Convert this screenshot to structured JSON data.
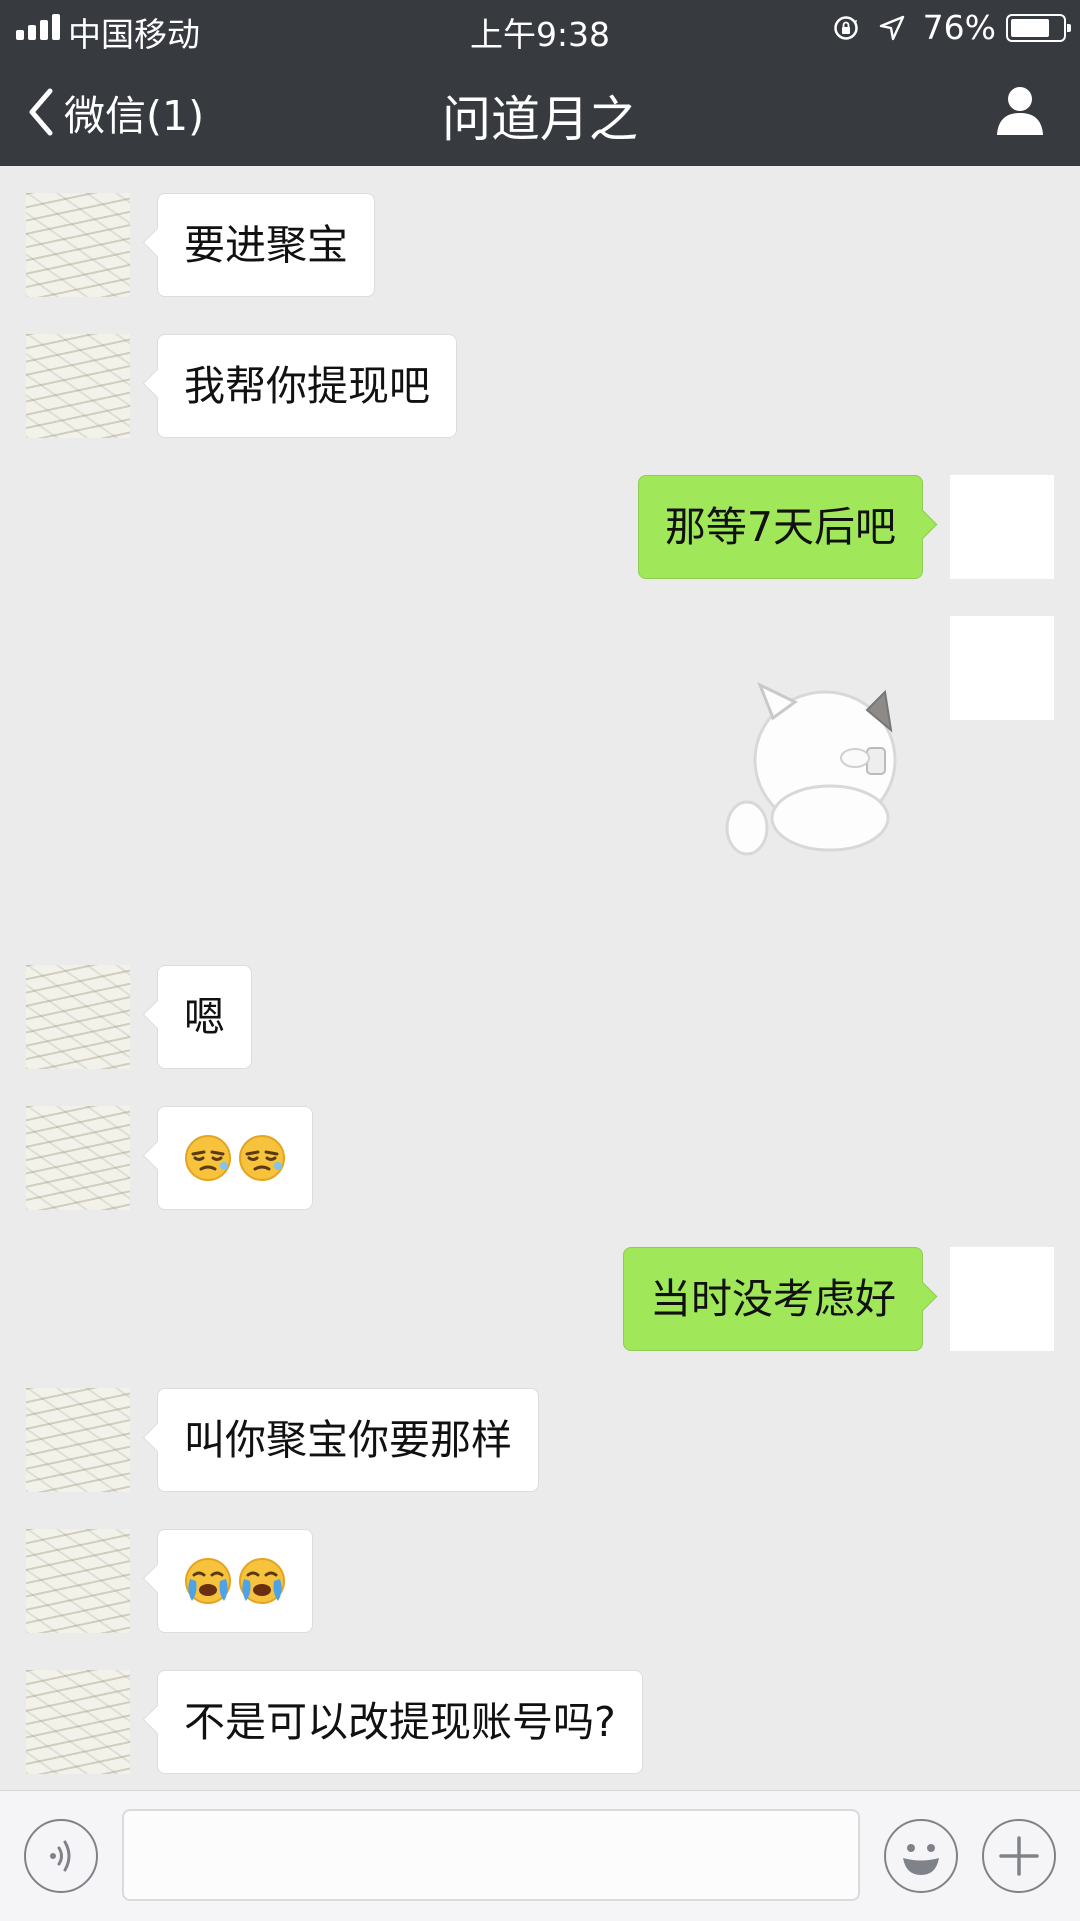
{
  "status_bar": {
    "carrier": "中国移动",
    "time": "上午9:38",
    "battery": "76%",
    "battery_level": 0.76
  },
  "nav": {
    "back_label": "微信(1)",
    "title": "问道月之"
  },
  "messages": [
    {
      "side": "left",
      "type": "text",
      "text": "要进聚宝"
    },
    {
      "side": "left",
      "type": "text",
      "text": "我帮你提现吧"
    },
    {
      "side": "right",
      "type": "text",
      "text": "那等7天后吧"
    },
    {
      "side": "right",
      "type": "sticker",
      "sticker": "white-cat-sticker"
    },
    {
      "side": "left",
      "type": "text",
      "text": "嗯"
    },
    {
      "side": "left",
      "type": "emoji",
      "emoji": [
        "smirk-face-emoji",
        "smirk-face-emoji"
      ]
    },
    {
      "side": "right",
      "type": "text",
      "text": "当时没考虑好"
    },
    {
      "side": "left",
      "type": "text",
      "text": "叫你聚宝你要那样"
    },
    {
      "side": "left",
      "type": "emoji",
      "emoji": [
        "crying-face-emoji",
        "crying-face-emoji"
      ]
    },
    {
      "side": "left",
      "type": "text",
      "text": "不是可以改提现账号吗?"
    }
  ],
  "input": {
    "value": "",
    "placeholder": ""
  },
  "colors": {
    "nav_bg": "#373a3f",
    "chat_bg": "#ebebeb",
    "sent_bubble": "#a0e75a",
    "received_bubble": "#ffffff"
  }
}
